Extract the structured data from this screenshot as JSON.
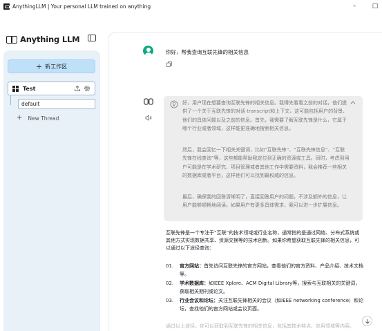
{
  "window": {
    "title": "AnythingLLM | Your personal LLM trained on anything",
    "minimize_symbol": "–",
    "maximize_symbol": "□"
  },
  "sidebar": {
    "brand": "Anything LLM",
    "new_workspace_label": "新工作区",
    "workspace": {
      "name": "Test",
      "threads": [
        {
          "label": "default"
        }
      ],
      "new_thread_label": "New Thread"
    }
  },
  "chat": {
    "user_message": "你好，帮我查询互联先锋的相关信息",
    "thinking": [
      "好，用户现在想要查询互联先锋的相关信息。我得先看看之前的对话，他们提供了一个关于互联先锋的对话 transcript和上下文，这可能包括用户的背景、他们的具体问题以及之前的信息。首先，我需要了解互联先锋是什么，它属于哪个行业或者领域，这样能更准确地搜索相关信息。",
      "然后，我会回忆一下相关关键词，比如“互联先锋”、“互联先锋信息”、“互联先锋在线查询”等，这些都能帮助我定位到正确的资源或工具。同时，考虑到用户可能是在学术研究、项目管理或者其他工作中需要资料，我会推荐一些相关的数据库或者平台，这样他们可以找到最权威的信息。",
      "最后，确保我的回答清晰明了，直接回答用户的问题，不涉及额外的信息，让用户能够顺畅地阅读。如果用户有更多具体需求，我可以进一步扩展信息。"
    ],
    "answer_intro": "互联先锋是一个专注于“互联”的技术领域或行业名称，通常指的是通过网络、分布式系统或其他方式实现数据共享、资源交换等的技术创新。如果你希望获取互联先锋的相关信息，可以通过以下途径查询：",
    "answer_items": [
      {
        "num": "01.",
        "title": "官方网站：",
        "text": "首先访问互联先锋的官方网站，查看他们的官方资料、产品介绍、技术文档等。"
      },
      {
        "num": "02.",
        "title": "学术数据库：",
        "text": "如IEEE Xplore、ACM Digital Library等，搜索与互联相关的关键词，获取相关期刊或论文。"
      },
      {
        "num": "03.",
        "title": "行业会议和论坛：",
        "text": "关注互联先锋相关的会议（如IEEE networking conference）和论坛，查找他们的官方网站或会议页面。"
      }
    ],
    "answer_cutoff": "通过以上途径，你可以获取到互联先锋的相关信息，包括其技术特点、应用领域等内容。"
  }
}
